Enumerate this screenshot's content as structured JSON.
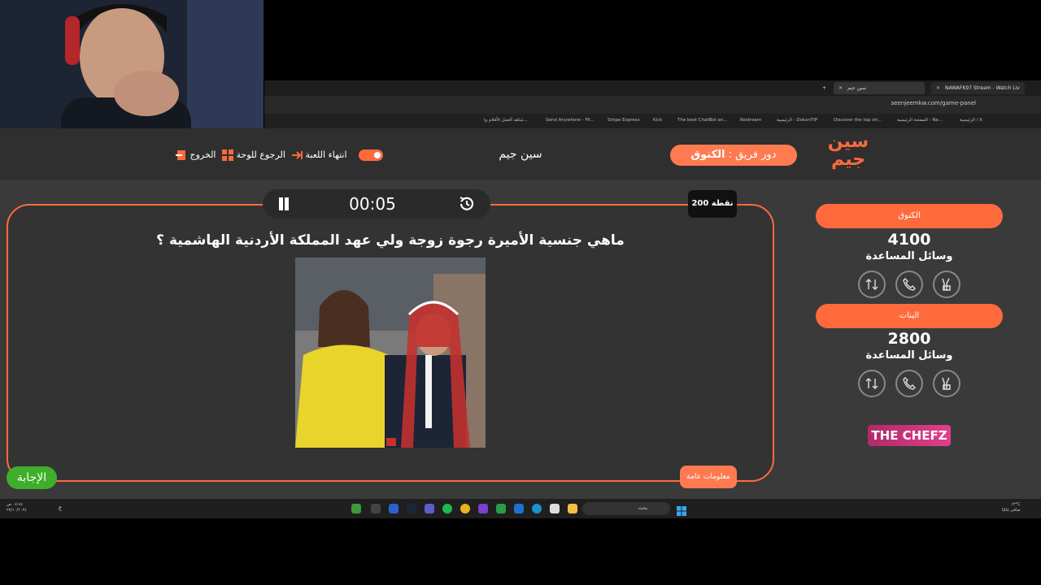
{
  "browser": {
    "tabs": [
      {
        "label": "NAWAFK97 Stream - Watch Liv"
      },
      {
        "label": "سين جيم"
      }
    ],
    "url": "seenjeemkw.com/game-panel",
    "bookmarks": [
      "الرئيسية / X",
      "الصفحة الرئيسية - Ne...",
      "Discover the top str...",
      "الرئيسية - DokanTIP",
      "Restream",
      "The best ChatBot an...",
      "Kick",
      "Stripe Express",
      "Send Anywhere - Fil...",
      "شاهد أفضل الأفلام وا..."
    ]
  },
  "header": {
    "logo_text": "سين جيم",
    "turn_prefix": "دور فريق :",
    "turn_team": "الكنوق",
    "game_title": "سين جيم",
    "end_game_label": "انتهاء اللعبة",
    "back_to_board_label": "الرجوع للوحة",
    "exit_label": "الخروج"
  },
  "question": {
    "timer": "00:05",
    "points": "200 نقطة",
    "text": "ماهي جنسية الأميرة رجوة زوجة ولي عهد المملكة الأردنية الهاشمية ؟",
    "category": "معلومات عامة",
    "answer_label": "الإجابة"
  },
  "teams": [
    {
      "name": "الكنوق",
      "score": "4100",
      "help_label": "وسائل المساعدة"
    },
    {
      "name": "البنات",
      "score": "2800",
      "help_label": "وسائل المساعدة"
    }
  ],
  "sponsor": "THE CHEFZ",
  "taskbar": {
    "search_placeholder": "بحث",
    "clock_time": "٠٤:٤٤ ص",
    "clock_date": "٢٧/١٠/٢٠٢٤",
    "temperature": "١٣°C",
    "weather": "صافي غالبًا",
    "lang": "ع"
  },
  "colors": {
    "accent": "#ff6a3d",
    "answer_green": "#3fae2a"
  }
}
